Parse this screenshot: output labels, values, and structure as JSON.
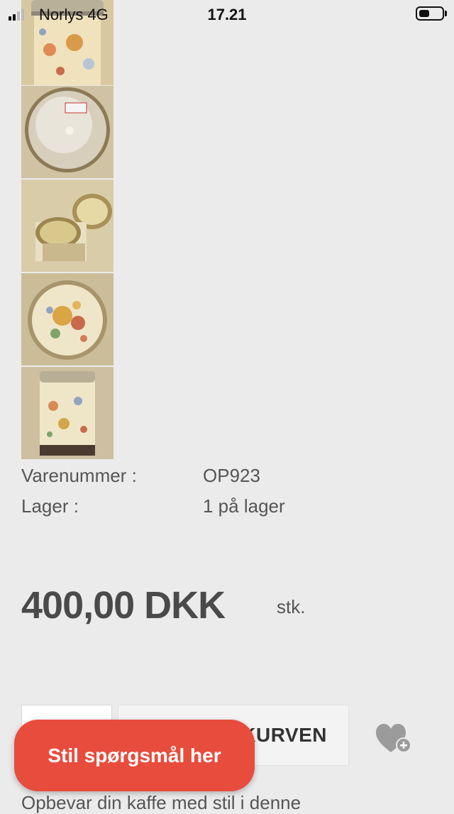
{
  "status_bar": {
    "carrier": "Norlys  4G",
    "time": "17.21",
    "signal_bars_active": 2,
    "signal_bars_total": 4,
    "battery_level": 0.45
  },
  "thumbnails": [
    {
      "icon": "tin-lid-top-image"
    },
    {
      "icon": "tin-bottom-image"
    },
    {
      "icon": "tin-open-image"
    },
    {
      "icon": "tin-lid-pattern-image"
    },
    {
      "icon": "tin-full-image"
    }
  ],
  "product": {
    "item_number_label": "Varenummer :",
    "item_number": "OP923",
    "stock_label": "Lager :",
    "stock_value": "1 på lager",
    "price": "400,00 DKK",
    "unit": "stk."
  },
  "cart": {
    "label": "KURVEN"
  },
  "ask_button": {
    "label": "Stil spørgsmål her"
  },
  "description_preview": "Opbevar din kaffe med stil i denne",
  "colors": {
    "background": "#ebebeb",
    "ask_button": "#e84c3d",
    "price_text": "#4a4a4a"
  }
}
